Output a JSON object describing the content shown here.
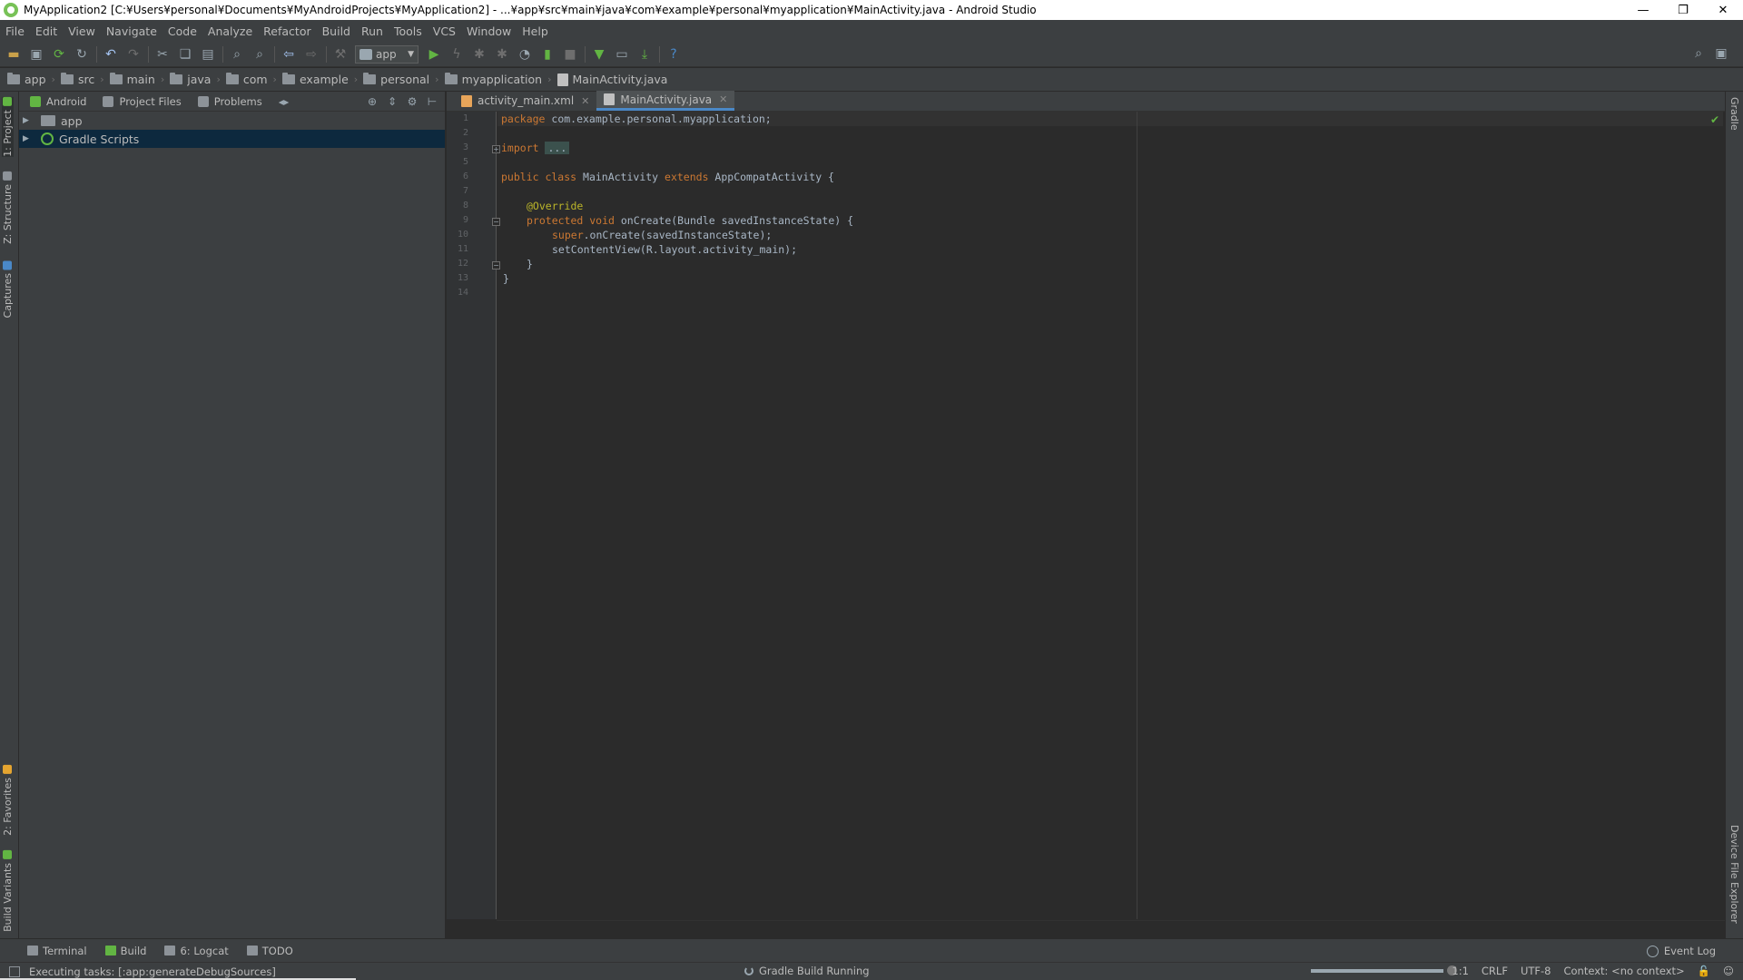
{
  "window": {
    "title": "MyApplication2 [C:¥Users¥personal¥Documents¥MyAndroidProjects¥MyApplication2] - ...¥app¥src¥main¥java¥com¥example¥personal¥myapplication¥MainActivity.java - Android Studio",
    "minimize": "—",
    "restore": "❐",
    "close": "✕"
  },
  "menu": [
    "File",
    "Edit",
    "View",
    "Navigate",
    "Code",
    "Analyze",
    "Refactor",
    "Build",
    "Run",
    "Tools",
    "VCS",
    "Window",
    "Help"
  ],
  "toolbar": {
    "run_config": "app",
    "icons": [
      "open-folder-icon",
      "save-icon",
      "sync-icon",
      "refresh-icon",
      "undo-icon",
      "redo-icon",
      "cut-icon",
      "copy-icon",
      "paste-icon",
      "find-icon",
      "replace-icon",
      "back-icon",
      "forward-icon",
      "build-hammer-icon",
      "run-icon",
      "apply-changes-icon",
      "debug-icon",
      "attach-debugger-icon",
      "profile-icon",
      "coverage-icon",
      "stop-icon",
      "sdk-manager-icon",
      "avd-manager-icon",
      "device-monitor-icon",
      "help-icon",
      "search-everywhere-icon",
      "layout-icon"
    ]
  },
  "breadcrumbs": [
    "app",
    "src",
    "main",
    "java",
    "com",
    "example",
    "personal",
    "myapplication",
    "MainActivity.java"
  ],
  "left_strip": {
    "project": "1: Project",
    "structure": "Z: Structure",
    "captures": "Captures",
    "favorites": "2: Favorites",
    "build_variants": "Build Variants"
  },
  "right_strip": {
    "gradle": "Gradle",
    "device_explorer": "Device File Explorer"
  },
  "project_panel": {
    "tabs": [
      "Android",
      "Project Files",
      "Problems"
    ],
    "tree": [
      {
        "label": "app",
        "selected": false
      },
      {
        "label": "Gradle Scripts",
        "selected": true
      }
    ]
  },
  "editor": {
    "tabs": [
      {
        "label": "activity_main.xml",
        "active": false
      },
      {
        "label": "MainActivity.java",
        "active": true
      }
    ],
    "line_numbers": [
      "1",
      "2",
      "3",
      "5",
      "6",
      "7",
      "8",
      "9",
      "10",
      "11",
      "12",
      "13",
      "14"
    ],
    "code": {
      "l1_kw": "package",
      "l1_rest": " com.example.personal.myapplication;",
      "l3_kw": "import",
      "l3_fold": "...",
      "l6_kw": "public class",
      "l6_name": " MainActivity ",
      "l6_kw2": "extends",
      "l6_rest": " AppCompatActivity {",
      "l8_ann": "@Override",
      "l9_kw": "protected void",
      "l9_rest": " onCreate(Bundle savedInstanceState) {",
      "l10_kw": "super",
      "l10_rest": ".onCreate(savedInstanceState);",
      "l11": "setContentView(R.layout.activity_main);",
      "l12": "}",
      "l13": "}"
    }
  },
  "tool_windows": [
    "Terminal",
    "Build",
    "6: Logcat",
    "TODO"
  ],
  "event_log": "Event Log",
  "status": {
    "message": "Executing tasks: [:app:generateDebugSources]",
    "background_task": "Gradle Build Running",
    "progress": 1.0,
    "position": "1:1",
    "line_sep": "CRLF",
    "encoding": "UTF-8",
    "context": "Context: <no context>",
    "accent": "#4a88c7"
  }
}
